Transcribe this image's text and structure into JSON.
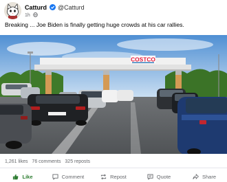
{
  "post": {
    "author_name": "Catturd",
    "author_handle": "@Catturd",
    "time": "1h",
    "text": "Breaking ... Joe Biden is finally getting huge crowds at his car rallies."
  },
  "photo": {
    "sign_text": "COSTCO"
  },
  "stats": {
    "likes": "1,261 likes",
    "comments": "76 comments",
    "reposts": "325 reposts"
  },
  "actions": {
    "like": "Like",
    "comment": "Comment",
    "repost": "Repost",
    "quote": "Quote",
    "share": "Share"
  },
  "colors": {
    "verified": "#1877f2",
    "like_active": "#2e7d32",
    "muted_text": "#65676b",
    "costco_red": "#e31837",
    "costco_blue": "#005daa"
  },
  "icons": {
    "verified": "verified-badge-icon",
    "globe": "globe-icon",
    "like": "thumbs-up-icon",
    "comment": "comment-bubble-icon",
    "repost": "repost-arrows-icon",
    "quote": "quote-bubble-icon",
    "share": "share-arrow-icon"
  }
}
